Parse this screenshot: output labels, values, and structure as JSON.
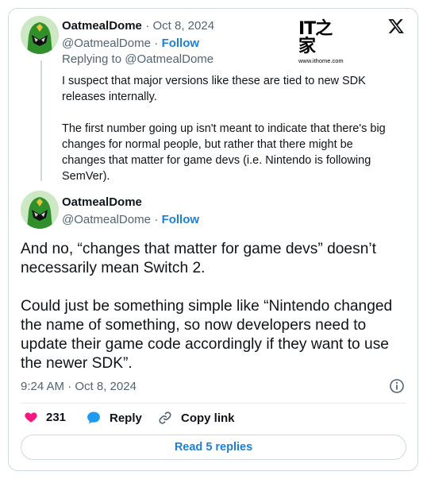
{
  "parent": {
    "display_name": "OatmealDome",
    "date": "Oct 8, 2024",
    "handle": "@OatmealDome",
    "follow_label": "Follow",
    "replying_to_prefix": "Replying to ",
    "replying_to_handle": "@OatmealDome",
    "text": "I suspect that major versions like these are tied to new SDK releases internally.\n\nThe first number going up isn't meant to indicate that there's big changes for normal people, but rather that there might be changes that matter for game devs (i.e. Nintendo is following SemVer)."
  },
  "main": {
    "display_name": "OatmealDome",
    "handle": "@OatmealDome",
    "follow_label": "Follow",
    "text": "And no, “changes that matter for game devs” doesn’t necessarily mean Switch 2.\n\nCould just be something simple like “Nintendo changed the name of something, so now developers need to update their game code accordingly if they want to use the newer SDK”.",
    "time": "9:24 AM · Oct 8, 2024"
  },
  "actions": {
    "likes": "231",
    "reply_label": "Reply",
    "copy_link_label": "Copy link"
  },
  "read_replies_label": "Read 5 replies",
  "watermark": {
    "logo_text": "IT之家",
    "url": "www.ithome.com"
  },
  "colors": {
    "accent_blue": "#1d9bf0",
    "like_red": "#f91880",
    "muted_gray": "#536471",
    "border": "#cfd9de"
  },
  "icons": [
    "x-logo-icon",
    "heart-icon",
    "reply-bubble-icon",
    "link-icon",
    "info-icon",
    "avatar-image"
  ]
}
